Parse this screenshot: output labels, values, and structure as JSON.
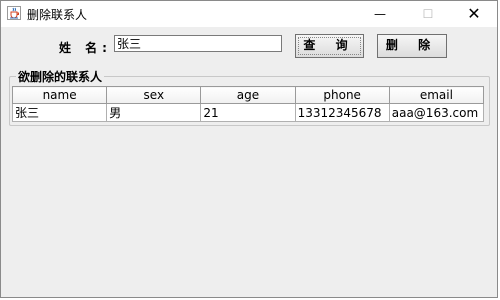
{
  "window": {
    "title": "删除联系人",
    "minimize_glyph": "—",
    "maximize_glyph": "☐",
    "close_glyph": "✕",
    "icon": "java-cup-icon"
  },
  "form": {
    "name_label": "姓 名:",
    "name_value": "张三",
    "query_label": "查 询",
    "delete_label": "删 除"
  },
  "group": {
    "title": "欲删除的联系人"
  },
  "table": {
    "columns": [
      "name",
      "sex",
      "age",
      "phone",
      "email"
    ],
    "rows": [
      [
        "张三",
        "男",
        "21",
        "13312345678",
        "aaa@163.com"
      ]
    ]
  }
}
